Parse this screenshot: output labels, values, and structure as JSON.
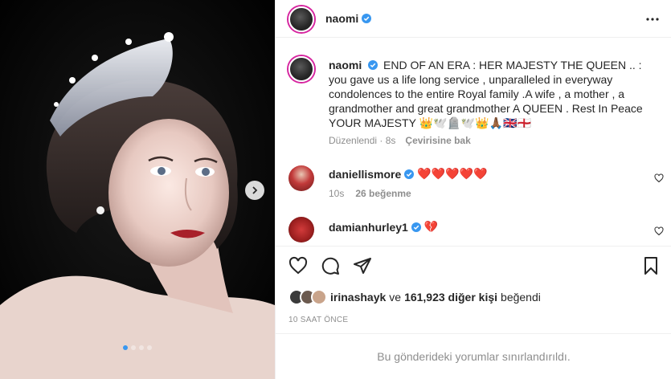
{
  "post_author": {
    "username": "naomi",
    "verified_icon": "verified-badge-icon"
  },
  "caption": {
    "username": "naomi",
    "text": "END OF AN ERA : HER MAJESTY THE QUEEN .. : you gave us a life long service , unparalleled in everyway condolences to the entire Royal family .A wife , a mother , a grandmother and great grandmother A QUEEN . Rest In Peace YOUR MAJESTY 👑🕊️🪦🕊️👑🙏🏾🇬🇧🏴󠁧󠁢󠁥󠁮󠁧󠁿",
    "edited": "Düzenlendi",
    "age": "8s",
    "translate": "Çevirisine bak"
  },
  "comments": [
    {
      "username": "daniellismore",
      "text": "❤️❤️❤️❤️❤️",
      "age": "10s",
      "likes": "26 beğenme"
    },
    {
      "username": "damianhurley1",
      "text": "💔"
    }
  ],
  "likes": {
    "first_user": "irinashayk",
    "connector": "ve",
    "others": "161,923 diğer kişi",
    "suffix": "beğendi"
  },
  "timestamp": "10 SAAT ÖNCE",
  "comments_limited": "Bu gönderideki yorumlar sınırlandırıldı.",
  "colors": {
    "verified": "#3897f0",
    "muted": "#8e8e8e",
    "text": "#262626",
    "heart": "#ed4956"
  }
}
